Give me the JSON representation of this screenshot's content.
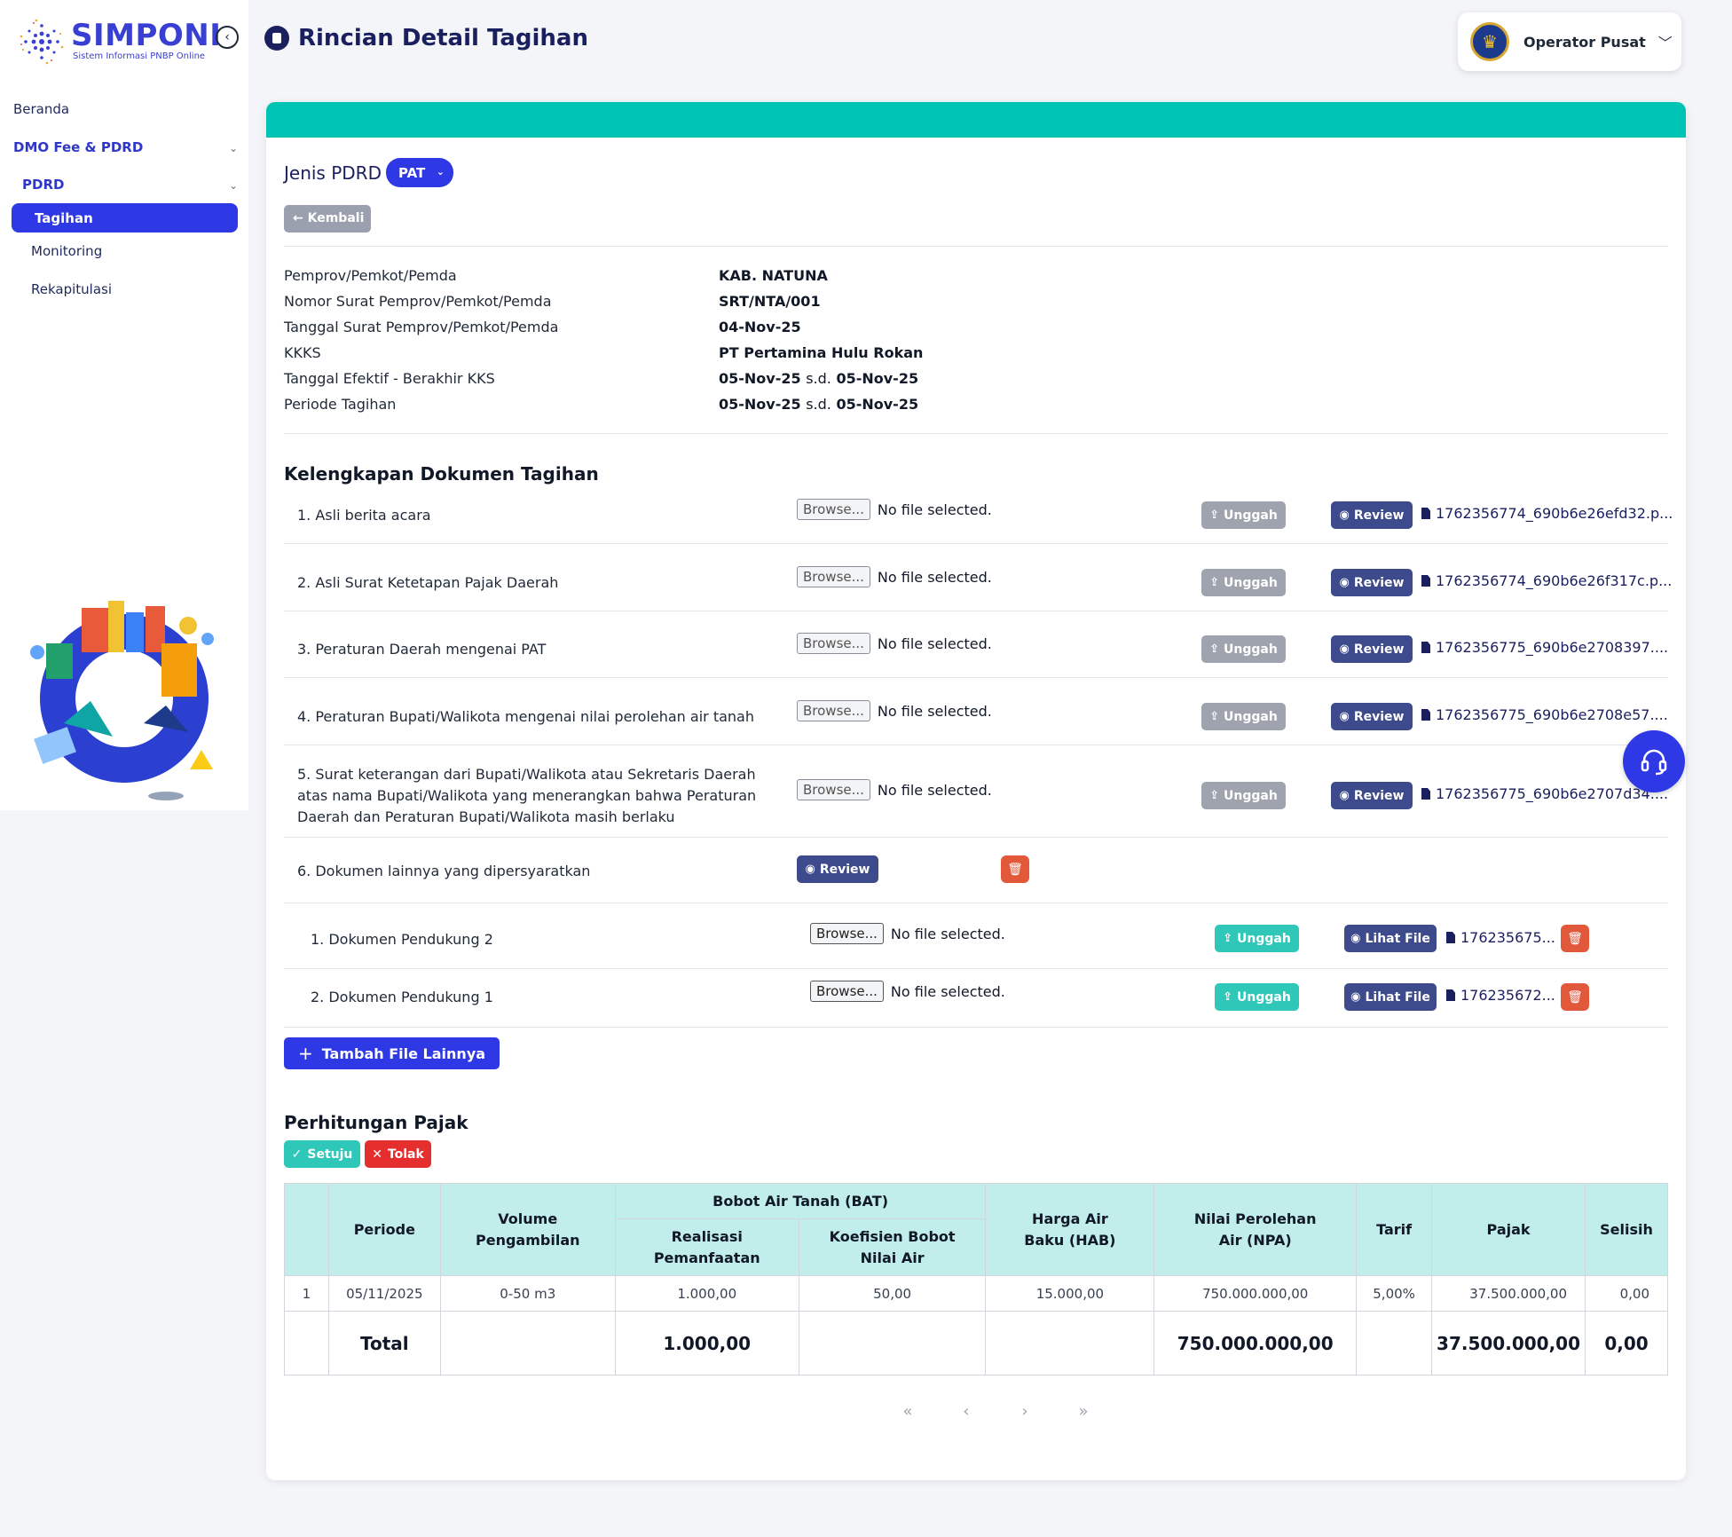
{
  "app": {
    "logo_name": "SIMPONI",
    "logo_tagline": "Sistem Informasi PNBP Online"
  },
  "sidebar": {
    "items": [
      {
        "label": "Beranda"
      },
      {
        "label": "DMO Fee & PDRD"
      },
      {
        "label": "PDRD"
      },
      {
        "label": "Tagihan"
      },
      {
        "label": "Monitoring"
      },
      {
        "label": "Rekapitulasi"
      }
    ]
  },
  "header": {
    "title": "Rincian Detail Tagihan",
    "user": "Operator Pusat"
  },
  "jenis": {
    "label": "Jenis PDRD",
    "value": "PAT",
    "back": "Kembali"
  },
  "info": [
    {
      "label": "Pemprov/Pemkot/Pemda",
      "value": "KAB. NATUNA"
    },
    {
      "label": "Nomor Surat Pemprov/Pemkot/Pemda",
      "value": "SRT/NTA/001"
    },
    {
      "label": "Tanggal Surat Pemprov/Pemkot/Pemda",
      "value": "04-Nov-25"
    },
    {
      "label": "KKKS",
      "value": "PT Pertamina Hulu Rokan"
    },
    {
      "label": "Tanggal Efektif - Berakhir KKS",
      "start": "05-Nov-25",
      "sep": "s.d.",
      "end": "05-Nov-25"
    },
    {
      "label": "Periode Tagihan",
      "start": "05-Nov-25",
      "sep": "s.d.",
      "end": "05-Nov-25"
    }
  ],
  "docs": {
    "title": "Kelengkapan Dokumen Tagihan",
    "browse_label": "Browse...",
    "no_file": "No file selected.",
    "upload_label": "Unggah",
    "review_label": "Review",
    "lihat_label": "Lihat File",
    "items": [
      {
        "label": "1. Asli berita acara",
        "file": "1762356774_690b6e26efd32.p..."
      },
      {
        "label": "2. Asli Surat Ketetapan Pajak Daerah",
        "file": "1762356774_690b6e26f317c.p..."
      },
      {
        "label": "3. Peraturan Daerah mengenai PAT",
        "file": "1762356775_690b6e2708397...."
      },
      {
        "label": "4. Peraturan Bupati/Walikota mengenai nilai perolehan air tanah",
        "file": "1762356775_690b6e2708e57...."
      },
      {
        "label": "5. Surat keterangan dari Bupati/Walikota atau Sekretaris Daerah atas nama Bupati/Walikota yang menerangkan bahwa Peraturan Daerah dan Peraturan Bupati/Walikota masih berlaku",
        "file": "1762356775_690b6e2707d34...."
      },
      {
        "label": "6. Dokumen lainnya yang dipersyaratkan"
      }
    ],
    "sub_items": [
      {
        "label": "1. Dokumen Pendukung 2",
        "file": "176235675..."
      },
      {
        "label": "2. Dokumen Pendukung 1",
        "file": "176235672..."
      }
    ],
    "add_label": "Tambah File Lainnya"
  },
  "pajak": {
    "title": "Perhitungan Pajak",
    "approve": "Setuju",
    "reject": "Tolak",
    "headers": {
      "periode": "Periode",
      "volume": "Volume Pengambilan",
      "bat": "Bobot Air Tanah (BAT)",
      "realisasi": "Realisasi Pemanfaatan",
      "koefisien": "Koefisien Bobot Nilai Air",
      "hab": "Harga Air Baku (HAB)",
      "npa": "Nilai Perolehan Air (NPA)",
      "tarif": "Tarif",
      "pajak": "Pajak",
      "selisih": "Selisih"
    },
    "rows": [
      {
        "no": "1",
        "periode": "05/11/2025",
        "volume": "0-50 m3",
        "realisasi": "1.000,00",
        "koefisien": "50,00",
        "hab": "15.000,00",
        "npa": "750.000.000,00",
        "tarif": "5,00%",
        "pajak": "37.500.000,00",
        "selisih": "0,00"
      }
    ],
    "total": {
      "label": "Total",
      "realisasi": "1.000,00",
      "npa": "750.000.000,00",
      "pajak": "37.500.000,00",
      "selisih": "0,00"
    }
  },
  "pager": [
    "«",
    "‹",
    "›",
    "»"
  ]
}
